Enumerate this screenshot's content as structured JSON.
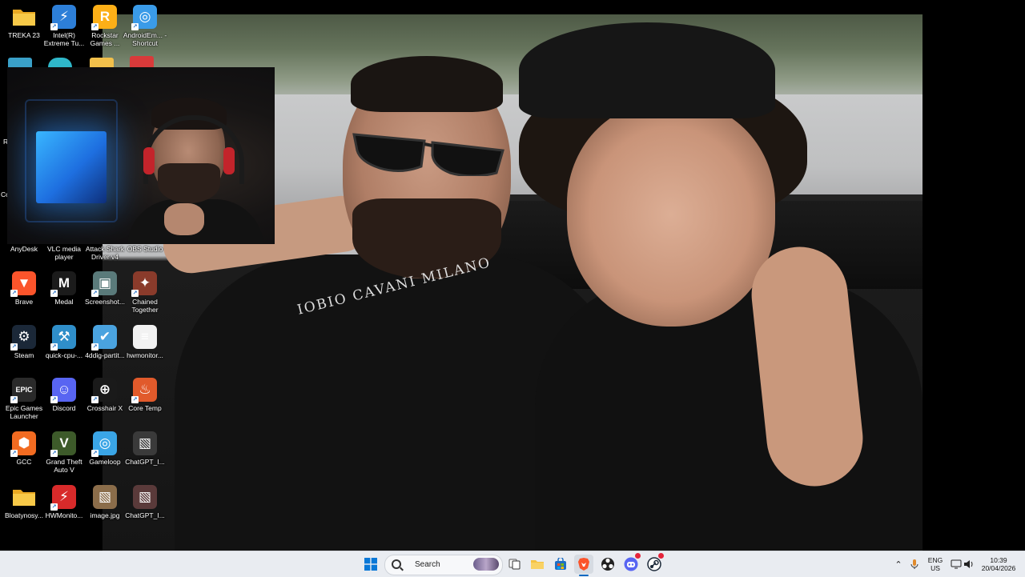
{
  "desktop": {
    "icons": [
      {
        "label": "TREKA 23",
        "icon": "folder-icon",
        "color": "#f2c04b"
      },
      {
        "label": "Intel(R) Extreme Tu...",
        "icon": "intel-xtu-icon",
        "color": "#2d7fd8"
      },
      {
        "label": "Rockstar Games ...",
        "icon": "rockstar-icon",
        "color": "#fcaf17"
      },
      {
        "label": "AndroidEm... - Shortcut",
        "icon": "android-emulator-icon",
        "color": "#3a9be8"
      },
      {
        "label": "AnyDesk",
        "icon": "anydesk-icon"
      },
      {
        "label": "VLC media player",
        "icon": "vlc-icon"
      },
      {
        "label": "Attack Shark Driver v4",
        "icon": "attack-shark-icon"
      },
      {
        "label": "OBS Studio",
        "icon": "obs-icon"
      },
      {
        "label": "Brave",
        "icon": "brave-icon",
        "color": "#fb542b"
      },
      {
        "label": "Medal",
        "icon": "medal-icon",
        "color": "#1b1b1b"
      },
      {
        "label": "Screenshot...",
        "icon": "screenshot-icon",
        "color": "#5a7a7a"
      },
      {
        "label": "Chained Together",
        "icon": "chained-together-icon",
        "color": "#8a3b2b"
      },
      {
        "label": "Steam",
        "icon": "steam-icon",
        "color": "#1b2838"
      },
      {
        "label": "quick-cpu-...",
        "icon": "quick-cpu-icon",
        "color": "#2f8ec9"
      },
      {
        "label": "4ddig-partit...",
        "icon": "4ddig-icon",
        "color": "#4aa3df"
      },
      {
        "label": "hwmonitor...",
        "icon": "file-icon",
        "color": "#f2f2f2"
      },
      {
        "label": "Epic Games Launcher",
        "icon": "epic-games-icon",
        "color": "#2a2a2a"
      },
      {
        "label": "Discord",
        "icon": "discord-icon",
        "color": "#5865f2"
      },
      {
        "label": "Crosshair X",
        "icon": "crosshair-x-icon",
        "color": "#1a1a1a"
      },
      {
        "label": "Core Temp",
        "icon": "core-temp-icon",
        "color": "#e15a2b"
      },
      {
        "label": "GCC",
        "icon": "gcc-icon",
        "color": "#f26b21"
      },
      {
        "label": "Grand Theft Auto V",
        "icon": "gta-v-icon",
        "color": "#3d5a2a"
      },
      {
        "label": "Gameloop",
        "icon": "gameloop-icon",
        "color": "#3aa5e6"
      },
      {
        "label": "ChatGPT_I...",
        "icon": "image-file-icon",
        "color": "#3a3a3a"
      },
      {
        "label": "Bloatynosy...",
        "icon": "folder-icon",
        "color": "#f2c04b"
      },
      {
        "label": "HWMonito...",
        "icon": "hwmonitor-icon",
        "color": "#d82a2a"
      },
      {
        "label": "image.jpg",
        "icon": "image-file-icon",
        "color": "#8b6d4a"
      },
      {
        "label": "ChatGPT_I...",
        "icon": "image-file-icon",
        "color": "#5a3a3a"
      }
    ],
    "partial_labels": [
      "R",
      "Co"
    ],
    "wallpaper_collar_text": "IOBIO CAVANI MILANO"
  },
  "taskbar": {
    "search_placeholder": "Search",
    "apps": [
      {
        "name": "start",
        "icon": "windows-start-icon"
      },
      {
        "name": "task-view",
        "icon": "task-view-icon"
      },
      {
        "name": "file-explorer",
        "icon": "file-explorer-icon"
      },
      {
        "name": "microsoft-store",
        "icon": "store-icon"
      },
      {
        "name": "brave",
        "icon": "brave-icon"
      },
      {
        "name": "obs",
        "icon": "obs-icon"
      },
      {
        "name": "discord",
        "icon": "discord-icon"
      },
      {
        "name": "steam",
        "icon": "steam-icon"
      }
    ],
    "tray": {
      "language_top": "ENG",
      "language_bottom": "US",
      "time": "10:39",
      "date": "20/04/2026"
    }
  },
  "colors": {
    "taskbar_bg": "#e9ecf1",
    "accent": "#0067c0"
  }
}
